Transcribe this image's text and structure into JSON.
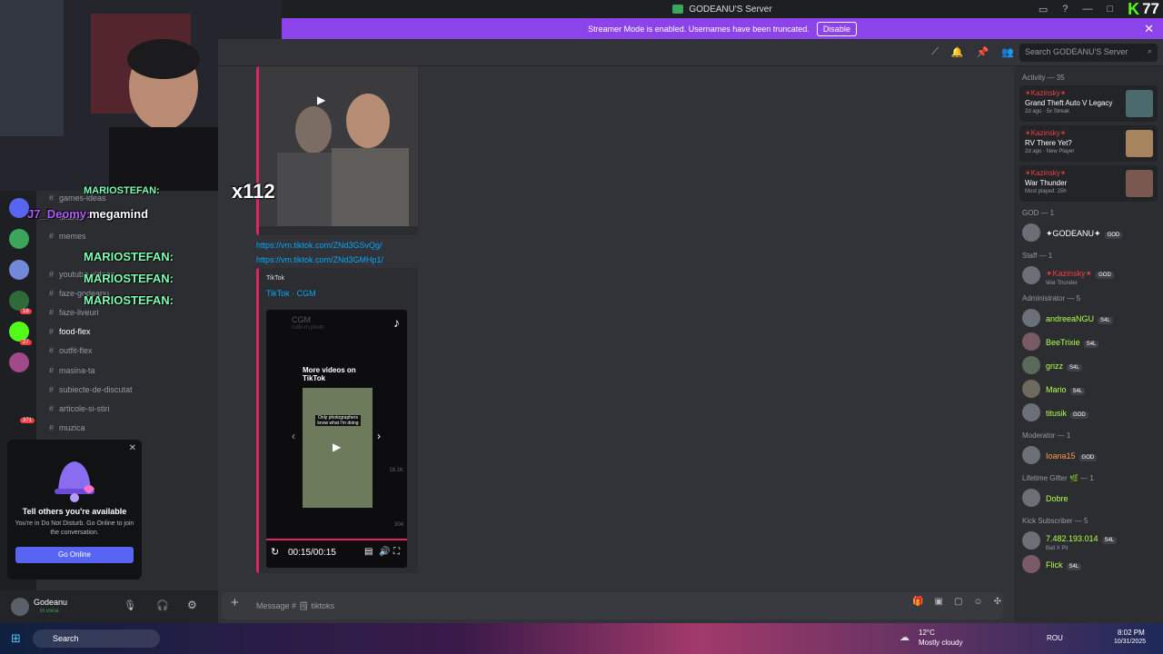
{
  "window": {
    "title": "GODEANU'S Server"
  },
  "kick": {
    "logo": "K",
    "count": "77"
  },
  "banner": {
    "text": "Streamer Mode is enabled. Usernames have been truncated.",
    "button": "Disable"
  },
  "header": {
    "search_placeholder": "Search GODEANU'S Server"
  },
  "overlay": {
    "multiplier": "x112",
    "names": [
      "MARIOSTEFAN:",
      "MARIOSTEFAN:",
      "MARIOSTEFAN:",
      "MARIOSTEFAN:"
    ],
    "deomy": "J7_Deomy:",
    "megamind": "megamind"
  },
  "channels": [
    {
      "name": "games-ideas"
    },
    {
      "name": "tiktoks"
    },
    {
      "name": "memes"
    },
    {
      "name": "youtube-videos"
    },
    {
      "name": "faze-godeanu"
    },
    {
      "name": "faze-liveuri"
    },
    {
      "name": "food-flex"
    },
    {
      "name": "outfit-flex"
    },
    {
      "name": "masina-ta"
    },
    {
      "name": "subiecte-de-discutat"
    },
    {
      "name": "articole-si-stiri"
    },
    {
      "name": "muzica"
    }
  ],
  "server_badges": [
    "1",
    "18",
    "6",
    "27",
    "1",
    "371",
    "4"
  ],
  "popup": {
    "title": "Tell others you're available",
    "body": "You're in Do Not Disturb. Go Online to join the conversation.",
    "button": "Go Online"
  },
  "user": {
    "name": "Godeanu",
    "status": "In voice"
  },
  "chat": {
    "links": [
      "https://vm.tiktok.com/ZNd3GSvQg/",
      "https://vm.tiktok.com/ZNd3GMHp1/"
    ],
    "embed": {
      "provider": "TikTok",
      "title": "TikTok · CGM",
      "author": "CGM",
      "handle": "colin.m.photo",
      "more": "More videos on TikTok",
      "thumb_caption": "Only photographers know what I'm doing",
      "likes": "18.1K",
      "comments": "304",
      "time": "00:15/00:15",
      "progress": 1.0
    },
    "composer_placeholder": "Message # 🗒 tiktoks"
  },
  "members": {
    "activity_title": "Activity — 35",
    "activity": [
      {
        "name": "✴Kazinsky✴",
        "game": "Grand Theft Auto V Legacy",
        "meta1": "2d ago",
        "meta2": "5x Streak"
      },
      {
        "name": "✴Kazinsky✴",
        "game": "RV There Yet?",
        "meta1": "2d ago",
        "meta2": "New Player"
      },
      {
        "name": "✴Kazinsky✴",
        "game": "War Thunder",
        "meta1": "Most played: 25h",
        "meta2": ""
      }
    ],
    "groups": [
      {
        "title": "GOD — 1",
        "members": [
          {
            "name": "✦GODEANU✦",
            "badge": "GOD",
            "color": "#ffffff"
          }
        ]
      },
      {
        "title": "Staff — 1",
        "members": [
          {
            "name": "✴Kazinsky✴",
            "badge": "GOD",
            "sub": "War Thunder",
            "color": "#f23f42"
          }
        ]
      },
      {
        "title": "Administrator — 5",
        "members": [
          {
            "name": "andreeaNGU",
            "badge": "S4L",
            "color": "#b5ff4d"
          },
          {
            "name": "BeeTrixie",
            "badge": "S4L",
            "color": "#b5ff4d"
          },
          {
            "name": "grizz",
            "badge": "S4L",
            "color": "#b5ff4d"
          },
          {
            "name": "Mario",
            "badge": "S4L",
            "color": "#b5ff4d"
          },
          {
            "name": "titusik",
            "badge": "GOD",
            "color": "#b5ff4d"
          }
        ]
      },
      {
        "title": "Moderator — 1",
        "members": [
          {
            "name": "Ioana15",
            "badge": "GOD",
            "color": "#ff9a52"
          }
        ]
      },
      {
        "title": "Lifetime Gifter 🌿 — 1",
        "members": [
          {
            "name": "Dobre",
            "badge": "",
            "color": "#b5ff4d"
          }
        ]
      },
      {
        "title": "Kick Subscriber — 5",
        "members": [
          {
            "name": "7.482.193.014",
            "badge": "S4L",
            "sub": "Ball X Pit",
            "color": "#b5ff4d"
          },
          {
            "name": "Flick",
            "badge": "S4L",
            "color": "#b5ff4d"
          }
        ]
      }
    ]
  },
  "taskbar": {
    "search": "Search",
    "weather_temp": "12°C",
    "weather_desc": "Mostly cloudy",
    "lang": "ROU",
    "time": "8:02 PM",
    "date": "10/31/2025"
  },
  "colors": {
    "accent": "#5865f2",
    "banner": "#8c43ea",
    "kick": "#53fc18",
    "link": "#00a8fc"
  }
}
